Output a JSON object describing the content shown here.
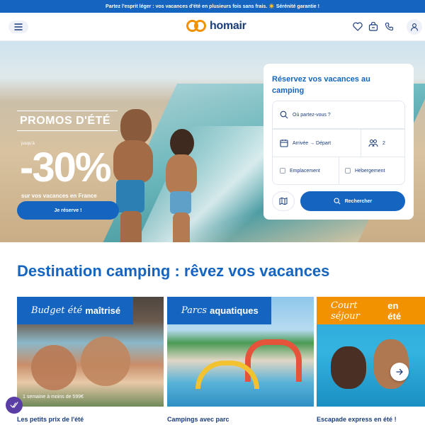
{
  "topbar": {
    "text": "Partez l'esprit léger : vos vacances d'été en plusieurs fois sans frais. ☀️ Sérénité garantie !"
  },
  "header": {
    "logo_text": "homair",
    "icons": [
      "menu-icon",
      "heart-icon",
      "bag-icon",
      "phone-icon",
      "user-icon"
    ]
  },
  "hero": {
    "promo_title": "PROMOS D'ÉTÉ",
    "promo_small": "jusqu'à",
    "promo_percent": "-30%",
    "promo_subtitle": "sur vos vacances en France",
    "cta_label": "Je réserve !"
  },
  "booking": {
    "title": "Réservez vos vacances au camping",
    "destination_placeholder": "Où partez-vous ?",
    "dates_label": "Arrivée → Départ",
    "guests_count": "2",
    "option_1": "Emplacement",
    "option_2": "Hébergement",
    "search_label": "Rechercher"
  },
  "section": {
    "title": "Destination camping : rêvez vos vacances"
  },
  "cards": [
    {
      "tag_italic": "Budget été",
      "tag_bold": "maîtrisé",
      "caption": "1 semaine à moins de 599€",
      "label": "Les petits prix de l'été",
      "tag_color": "#1565c0"
    },
    {
      "tag_italic": "Parcs",
      "tag_bold": "aquatiques",
      "caption": "",
      "label": "Campings avec parc",
      "tag_color": "#1565c0"
    },
    {
      "tag_italic": "Court séjour",
      "tag_bold": "en été",
      "caption": "",
      "label": "Escapade express en été !",
      "tag_color": "#f39200"
    }
  ],
  "colors": {
    "primary": "#1565c0",
    "accent": "#f39200",
    "navy": "#1a3d7c"
  }
}
